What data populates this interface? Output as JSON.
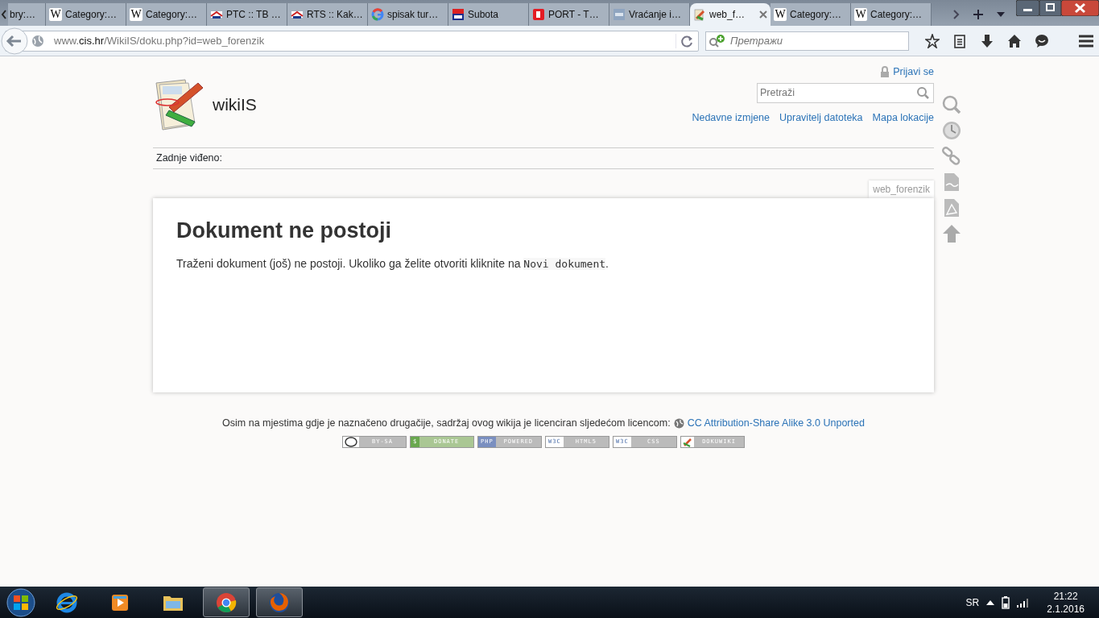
{
  "browser": {
    "tabs": [
      {
        "title": "bry:…",
        "selected": false
      },
      {
        "title": "Category:…",
        "kind": "wiki",
        "letter": "W",
        "selected": false
      },
      {
        "title": "Category:…",
        "kind": "wiki",
        "letter": "W",
        "selected": false
      },
      {
        "title": "PTC :: TB …",
        "kind": "rts",
        "selected": false
      },
      {
        "title": "RTS :: Kak…",
        "kind": "rts",
        "selected": false
      },
      {
        "title": "spisak tur…",
        "kind": "google",
        "selected": false
      },
      {
        "title": "Subota",
        "kind": "tv",
        "selected": false
      },
      {
        "title": "PORT - T…",
        "kind": "port",
        "selected": false
      },
      {
        "title": "Vraćanje i…",
        "kind": "mc",
        "selected": false
      },
      {
        "title": "web_f…",
        "kind": "dokuwiki",
        "selected": true
      },
      {
        "title": "Category:…",
        "kind": "wiki",
        "letter": "W",
        "selected": false
      },
      {
        "title": "Category:…",
        "kind": "wiki",
        "letter": "W",
        "selected": false
      }
    ],
    "url": {
      "prefix": "www.",
      "domain": "cis.hr",
      "path": "/WikiIS/doku.php?id=web_forenzik"
    },
    "search": {
      "placeholder": "Претражи"
    }
  },
  "wiki": {
    "login": "Prijavi se",
    "title": "wikiIS",
    "search": {
      "placeholder": "Pretraži"
    },
    "links": [
      "Nedavne izmjene",
      "Upravitelj datoteka",
      "Mapa lokacije"
    ],
    "breadcrumb": "Zadnje viđeno:",
    "page_id": "web_forenzik",
    "heading": "Dokument ne postoji",
    "text_before": "Traženi dokument (još) ne postoji. Ukoliko ga želite otvoriti kliknite na ",
    "code": "Novi dokument",
    "text_after": ".",
    "page_tools": [
      {
        "kind": "search"
      },
      {
        "kind": "history"
      },
      {
        "kind": "link"
      },
      {
        "kind": "odt"
      },
      {
        "kind": "pdf"
      },
      {
        "kind": "top"
      }
    ],
    "license_text": "Osim na mjestima gdje je naznačeno drugačije, sadržaj ovog wikija je licenciran sljedećom licencom:",
    "license_link": "CC Attribution-Share Alike 3.0 Unported",
    "badges": [
      {
        "kind": "cc",
        "label": "BY-SA"
      },
      {
        "kind": "donate",
        "prefix": "$",
        "label": "DONATE"
      },
      {
        "kind": "php",
        "prefix": "PHP",
        "label": "POWERED"
      },
      {
        "kind": "w3c",
        "prefix": "W3C",
        "label": "HTML5"
      },
      {
        "kind": "w3c",
        "prefix": "W3C",
        "label": "CSS"
      },
      {
        "kind": "dokuwiki",
        "label": "DOKUWIKI"
      }
    ]
  },
  "taskbar": {
    "apps": [
      {
        "kind": "ie",
        "running": false
      },
      {
        "kind": "media",
        "running": false
      },
      {
        "kind": "explorer",
        "running": false
      },
      {
        "kind": "chrome",
        "running": true
      },
      {
        "kind": "firefox",
        "running": true
      }
    ],
    "language": "SR",
    "time": "21:22",
    "date": "2.1.2016"
  }
}
